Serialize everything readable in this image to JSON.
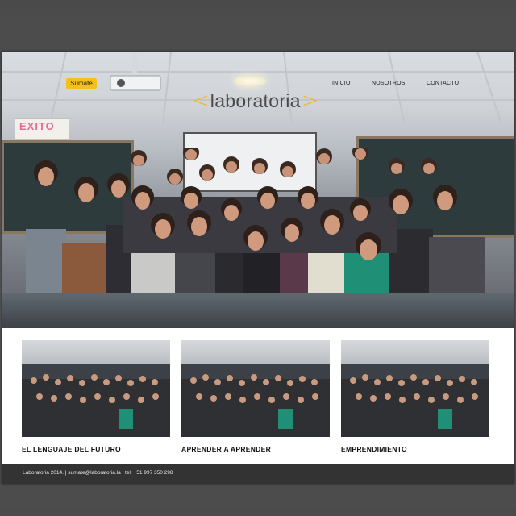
{
  "header": {
    "sumate_button": "Súmate",
    "logo_text": "laboratoria",
    "logo_bracket_left": "<",
    "logo_bracket_right": ">",
    "nav": [
      "INICIO",
      "NOSOTROS",
      "CONTACTO"
    ]
  },
  "hero": {
    "poster_text": "EXITO"
  },
  "cards": [
    {
      "title": "EL LENGUAJE DEL FUTURO"
    },
    {
      "title": "APRENDER A APRENDER"
    },
    {
      "title": "EMPRENDIMIENTO"
    }
  ],
  "footer": {
    "text": "Laboratoria 2014. | sumate@laboratoria.la | tel: +51 997 350 298"
  },
  "colors": {
    "accent": "#f5c01a",
    "logo_bracket": "#f5b51f",
    "footer_bg": "#333333",
    "page_bg": "#4f4f4f"
  },
  "icons": [
    "projector-icon",
    "ceiling-light-icon"
  ]
}
